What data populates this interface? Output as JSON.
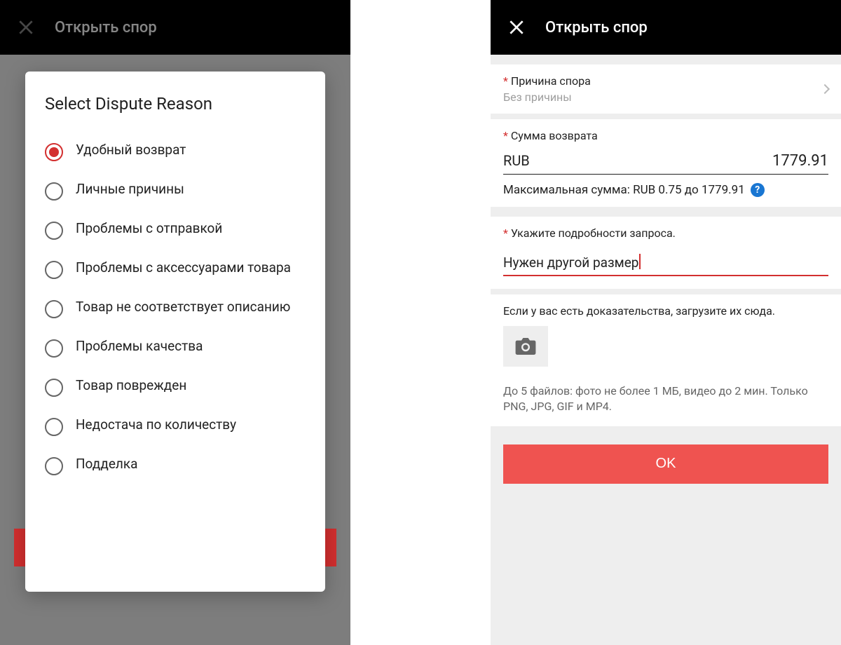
{
  "left": {
    "header_title": "Открыть спор",
    "modal_title": "Select Dispute Reason",
    "reasons": [
      "Удобный возврат",
      "Личные причины",
      "Проблемы с отправкой",
      "Проблемы с аксессуарами товара",
      "Товар не соответствует описанию",
      "Проблемы качества",
      "Товар поврежден",
      "Недостача по количеству",
      "Подделка"
    ]
  },
  "right": {
    "header_title": "Открыть спор",
    "reason_label": "Причина спора",
    "reason_value": "Без причины",
    "refund_label": "Сумма возврата",
    "currency": "RUB",
    "amount": "1779.91",
    "max_text": "Максимальная сумма: RUB 0.75 до 1779.91",
    "info_char": "?",
    "details_label": "Укажите подробности запроса.",
    "details_value": "Нужен другой размер",
    "evidence_text": "Если у вас есть доказательства, загрузите их сюда.",
    "file_hint": "До 5 файлов: фото не более 1 МБ, видео до 2 мин. Только PNG, JPG, GIF и MP4.",
    "ok_label": "OK",
    "asterisk": "*"
  }
}
